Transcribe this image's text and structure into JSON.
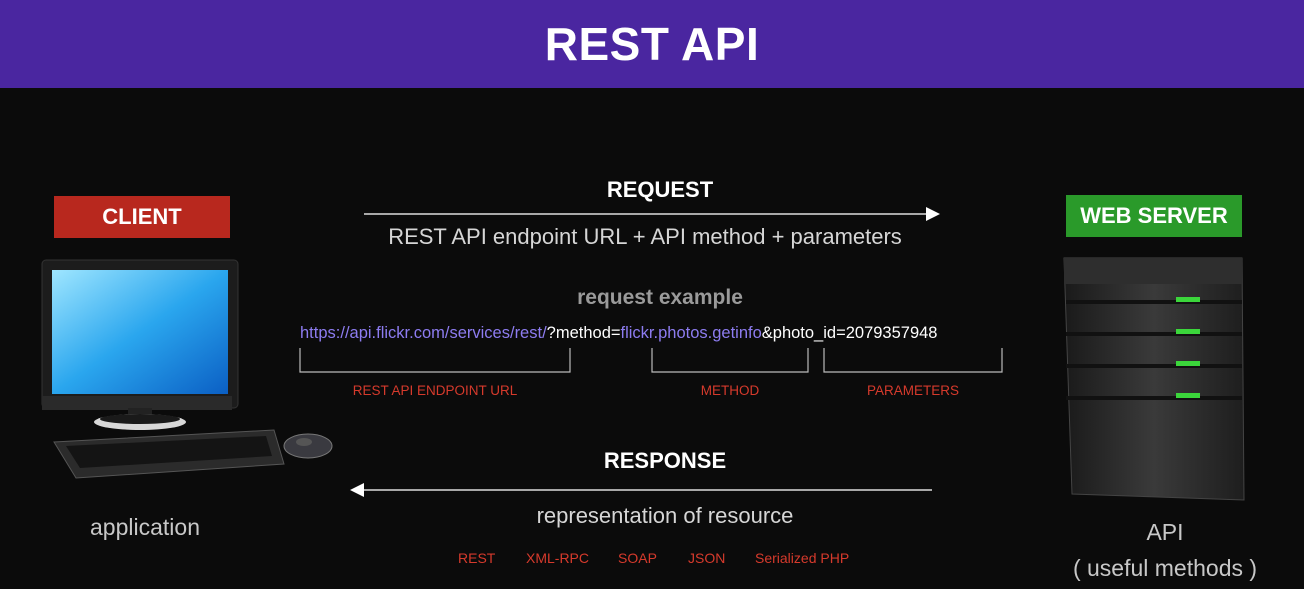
{
  "header": {
    "title": "REST API"
  },
  "client": {
    "badge": "CLIENT",
    "caption": "application",
    "badge_color": "#b8281e"
  },
  "server": {
    "badge": "WEB SERVER",
    "caption_line1": "API",
    "caption_line2": "( useful methods )",
    "badge_color": "#2a9a2a"
  },
  "request": {
    "title": "REQUEST",
    "description": "REST API endpoint URL + API method + parameters"
  },
  "example": {
    "title": "request example",
    "url_endpoint": "https://api.flickr.com/services/rest/",
    "url_method_key": "?method=",
    "url_method": "flickr.photos.getinfo",
    "url_params": "&photo_id=2079357948",
    "label_endpoint": "REST API ENDPOINT URL",
    "label_method": "METHOD",
    "label_params": "PARAMETERS"
  },
  "response": {
    "title": "RESPONSE",
    "description": "representation of resource",
    "formats": [
      "REST",
      "XML-RPC",
      "SOAP",
      "JSON",
      "Serialized PHP"
    ]
  },
  "colors": {
    "header": "#4a26a0",
    "accent_red": "#d63a2c",
    "url_purple": "#8d7cf0"
  }
}
